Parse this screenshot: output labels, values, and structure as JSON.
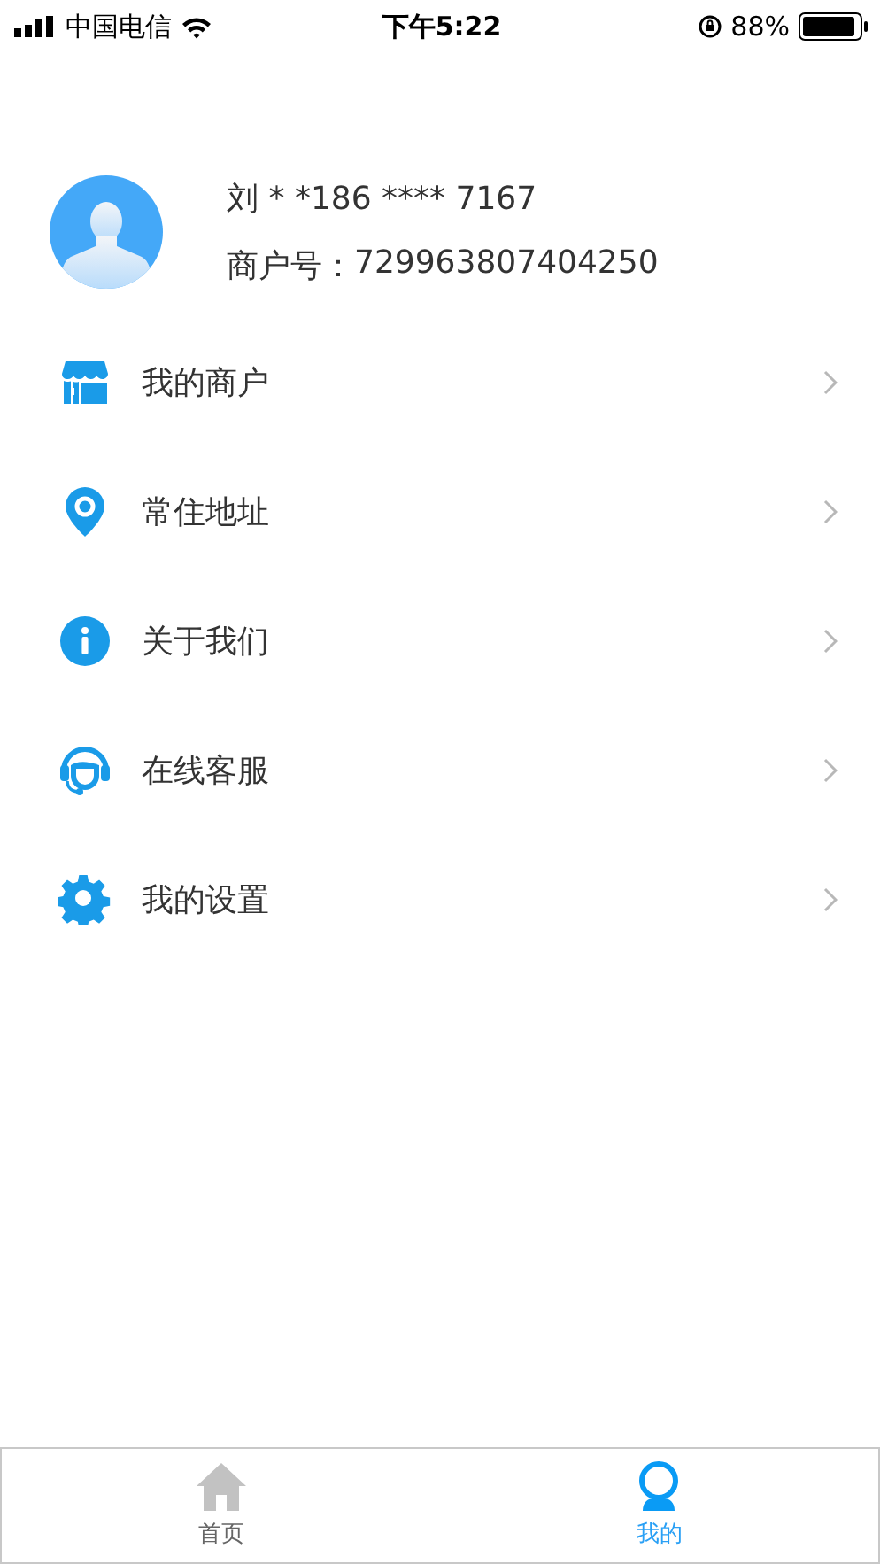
{
  "status_bar": {
    "carrier": "中国电信",
    "time": "下午5:22",
    "battery": "88%"
  },
  "profile": {
    "name": "刘 * *186 **** 7167",
    "merchant_label": "商户号：",
    "merchant_no": "729963807404250"
  },
  "menu": [
    {
      "kind": "shop",
      "label": "我的商户"
    },
    {
      "kind": "location",
      "label": "常住地址"
    },
    {
      "kind": "info",
      "label": "关于我们"
    },
    {
      "kind": "support",
      "label": "在线客服"
    },
    {
      "kind": "settings",
      "label": "我的设置"
    }
  ],
  "tabs": [
    {
      "kind": "home",
      "label": "首页",
      "selected": false
    },
    {
      "kind": "profile",
      "label": "我的",
      "selected": true
    }
  ]
}
